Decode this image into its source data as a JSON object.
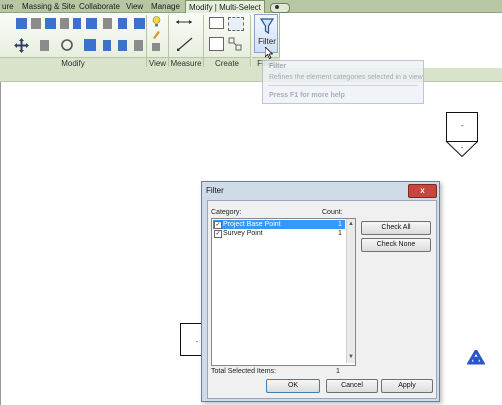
{
  "tabs": [
    {
      "label": "ure",
      "active": false
    },
    {
      "label": "Massing & Site",
      "active": false
    },
    {
      "label": "Collaborate",
      "active": false
    },
    {
      "label": "View",
      "active": false
    },
    {
      "label": "Manage",
      "active": false
    },
    {
      "label": "Modify | Multi-Select",
      "active": true
    }
  ],
  "ribbon": {
    "panels": [
      "Modify",
      "View",
      "Measure",
      "Create"
    ],
    "filter_button_label": "Filter",
    "filter_panel_label": "Filter"
  },
  "tooltip": {
    "title": "Filter",
    "description": "Refines the element categories selected in a view.",
    "help": "Press F1 for more help"
  },
  "dialog": {
    "title": "Filter",
    "close_label": "x",
    "category_header": "Category:",
    "count_header": "Count:",
    "rows": [
      {
        "label": "Project Base Point",
        "count": "1",
        "checked": true,
        "selected": true
      },
      {
        "label": "Survey Point",
        "count": "1",
        "checked": true,
        "selected": false
      }
    ],
    "check_all": "Check All",
    "check_none": "Check None",
    "total_label": "Total Selected Items:",
    "total_value": "1",
    "ok": "OK",
    "cancel": "Cancel",
    "apply": "Apply"
  },
  "canvas": {
    "elevation_marker_label": "-",
    "small_box_label": "-"
  },
  "colors": {
    "tab_bar": "#b7c7a3",
    "ribbon_bg": "#e3ebd8",
    "dialog_frame": "#cfdbe9",
    "selection": "#3399ff",
    "close_button": "#c9463d",
    "logo": "#2a55c9"
  },
  "icons": [
    "filter-icon",
    "move-icon",
    "align-icon",
    "rotate-icon",
    "trim-icon",
    "mirror-icon",
    "measure-icon",
    "dimension-icon",
    "create-group-icon",
    "revit-logo-icon"
  ]
}
